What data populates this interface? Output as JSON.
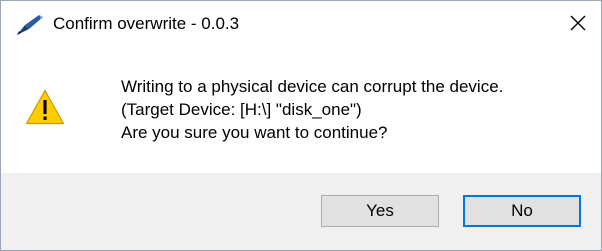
{
  "window": {
    "title": "Confirm overwrite - 0.0.3",
    "close_glyph": "✕"
  },
  "icons": {
    "app": "pen-app-icon",
    "warning": "warning-triangle-icon",
    "close": "close-icon"
  },
  "message": {
    "line1": "Writing to a physical device can corrupt the device.",
    "line2": "(Target Device: [H:\\] \"disk_one\")",
    "line3": "Are you sure you want to continue?"
  },
  "buttons": {
    "yes_label": "Yes",
    "no_label": "No"
  },
  "colors": {
    "accent": "#0078d7",
    "footer_bg": "#f0f0f0",
    "warning_fill": "#ffcc00"
  }
}
